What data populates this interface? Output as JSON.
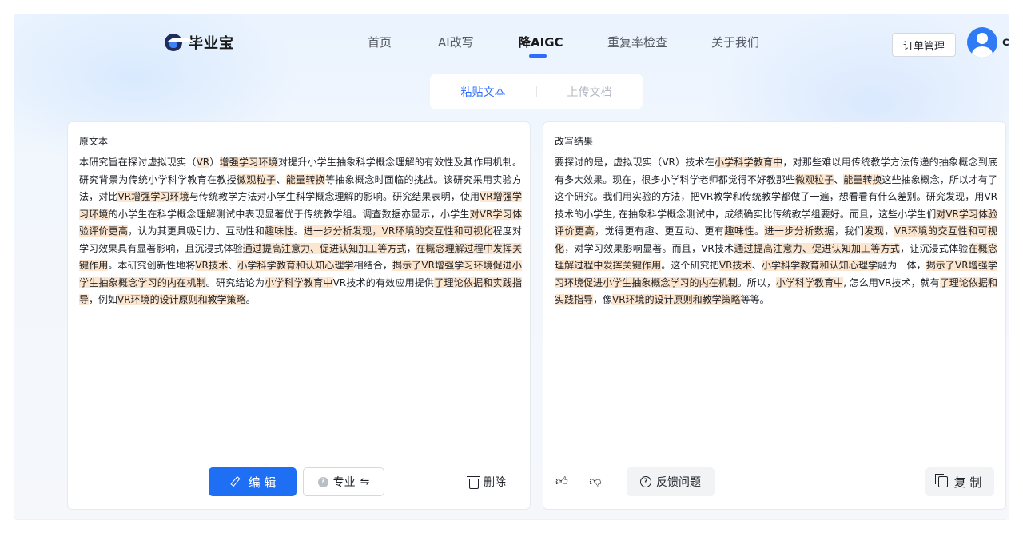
{
  "header": {
    "brand": "毕业宝",
    "nav": [
      {
        "label": "首页"
      },
      {
        "label": "AI改写"
      },
      {
        "label": "降AIGC"
      },
      {
        "label": "重复率检查"
      },
      {
        "label": "关于我们"
      }
    ],
    "active_nav": "降AIGC",
    "order_button": "订单管理",
    "user_initial": "c"
  },
  "tabs": [
    {
      "label": "粘贴文本",
      "active": true
    },
    {
      "label": "上传文档",
      "active": false
    }
  ],
  "left_panel": {
    "title": "原文本",
    "segments": [
      {
        "t": "本研究旨在探讨虚拟现实（"
      },
      {
        "t": "VR",
        "h": true
      },
      {
        "t": "）"
      },
      {
        "t": "增强学习环境",
        "h": true
      },
      {
        "t": "对提升小学生抽象科学概念理解的有效性及其作用机制。研究背景为传统小学科学教育在教授"
      },
      {
        "t": "微观粒子",
        "h": true
      },
      {
        "t": "、"
      },
      {
        "t": "能量转换",
        "h": true
      },
      {
        "t": "等抽象概念时面临的挑战。该研究采用实验方法，对比"
      },
      {
        "t": "VR增强学习环境",
        "h": true
      },
      {
        "t": "与传统教学方法对小学生科学概念理解的影响。研究结果表明，使用"
      },
      {
        "t": "VR增强学习环境",
        "h": true
      },
      {
        "t": "的小学生在科学概念理解测试中表现显著优于传统教学组。调查数据亦显示，小学生"
      },
      {
        "t": "对VR学习体验评价更高",
        "h": true
      },
      {
        "t": "，认为其更具吸引力、互动性和"
      },
      {
        "t": "趣味性",
        "h": true
      },
      {
        "t": "。"
      },
      {
        "t": "进一步分析发现，VR环境的交互性和可视化",
        "h": true
      },
      {
        "t": "程度对学习效果具有显著影响，且沉浸式体验"
      },
      {
        "t": "通过提高注意力、促进认知加工等方式",
        "h": true
      },
      {
        "t": "，"
      },
      {
        "t": "在概念理解过程中发挥关键作用",
        "h": true
      },
      {
        "t": "。本研究创新性地将"
      },
      {
        "t": "VR技术",
        "h": true
      },
      {
        "t": "、"
      },
      {
        "t": "小学科学教育和认知心理学",
        "h": true
      },
      {
        "t": "相结合，"
      },
      {
        "t": "揭示了VR增强学习环境促进小学生抽象概念学习的内在机制",
        "h": true
      },
      {
        "t": "。研究结论为"
      },
      {
        "t": "小学科学教育中",
        "h": true
      },
      {
        "t": "VR技术的有效应用提供"
      },
      {
        "t": "了理论依据和实践指导",
        "h": true
      },
      {
        "t": "，例如"
      },
      {
        "t": "VR环境的设计原则和教学策略",
        "h": true
      },
      {
        "t": "。"
      }
    ],
    "edit_button": "编 辑",
    "mode_button": "专业",
    "delete_button": "删除"
  },
  "right_panel": {
    "title": "改写结果",
    "segments": [
      {
        "t": "要探讨的是，虚拟现实（VR）技术在"
      },
      {
        "t": "小学科学教育中",
        "h": true
      },
      {
        "t": "，对那些难以用传统教学方法传递的抽象概念到底有多大效果。现在，很多小学科学老师都觉得不好教那些"
      },
      {
        "t": "微观粒子",
        "h": true
      },
      {
        "t": "、"
      },
      {
        "t": "能量转换",
        "h": true
      },
      {
        "t": "这些抽象概念，所以才有了这个研究。我们用实验的方法，把VR教学和传统教学都做了一遍，想看看有什么差别。研究发现，用VR技术的小学生, 在抽象科学概念测试中，成绩确实比传统教学组要好。而且，这些小学生们"
      },
      {
        "t": "对VR学习体验评价更高",
        "h": true
      },
      {
        "t": "，觉得更有趣、更互动、更有"
      },
      {
        "t": "趣味性",
        "h": true
      },
      {
        "t": "。"
      },
      {
        "t": "进一步分析数据",
        "h": true
      },
      {
        "t": "，我们"
      },
      {
        "t": "发现",
        "h": true
      },
      {
        "t": "，"
      },
      {
        "t": "VR环境的交互性和可视化",
        "h": true
      },
      {
        "t": "，对学习效果影响显著。而且，VR技术"
      },
      {
        "t": "通过提高注意力、促进认知加工等方式",
        "h": true
      },
      {
        "t": "，让沉浸式体验"
      },
      {
        "t": "在概念理解过程中发挥关键作用",
        "h": true
      },
      {
        "t": "。这个研究把"
      },
      {
        "t": "VR技术",
        "h": true
      },
      {
        "t": "、"
      },
      {
        "t": "小学科学教育和认知心理学",
        "h": true
      },
      {
        "t": "融为一体，"
      },
      {
        "t": "揭示了VR增强学习环境促进小学生抽象概念学习的内在机制",
        "h": true
      },
      {
        "t": "。所以，"
      },
      {
        "t": "小学科学教育中",
        "h": true
      },
      {
        "t": ", 怎么用VR技术，就有"
      },
      {
        "t": "了理论依据和实践指导",
        "h": true
      },
      {
        "t": "，像"
      },
      {
        "t": "VR环境的设计原则和教学策略",
        "h": true
      },
      {
        "t": "等等。"
      }
    ],
    "feedback_button": "反馈问题",
    "copy_button": "复 制"
  },
  "colors": {
    "accent": "#1f6ff5",
    "highlight": "#fde6cf"
  }
}
